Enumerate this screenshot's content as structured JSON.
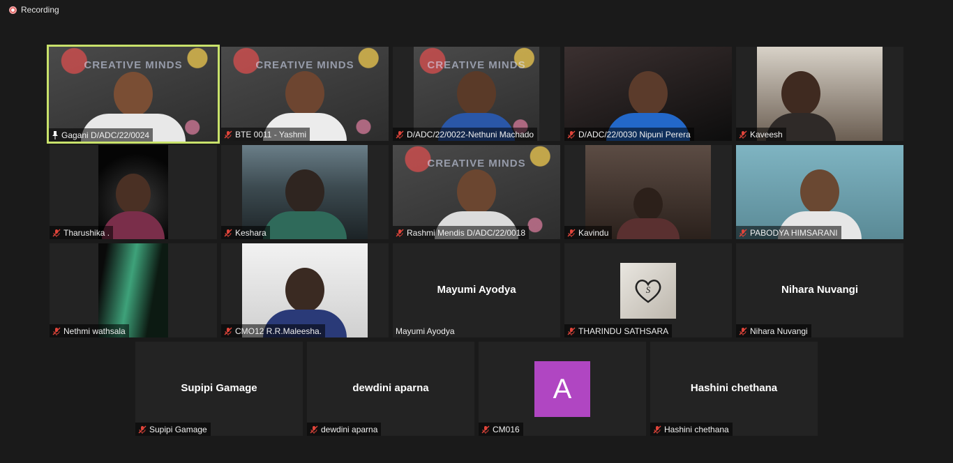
{
  "recording": {
    "label": "Recording"
  },
  "tiles": [
    {
      "name": "Gagani D/ADC/22/0024",
      "pinned": true
    },
    {
      "name": "BTE 0011 - Yashmi"
    },
    {
      "name": "D/ADC/22/0022-Nethuni Machado"
    },
    {
      "name": "D/ADC/22/0030 Nipuni Perera"
    },
    {
      "name": "Kaveesh"
    },
    {
      "name": "Tharushika ."
    },
    {
      "name": "Keshara"
    },
    {
      "name": "Rashmi Mendis D/ADC/22/0018"
    },
    {
      "name": "Kavindu"
    },
    {
      "name": "PABODYA HIMSARANI"
    },
    {
      "name": "Nethmi wathsala"
    },
    {
      "name": "CMO12 R.R.Maleesha."
    },
    {
      "name": "Mayumi Ayodya",
      "display": "Mayumi Ayodya"
    },
    {
      "name": "THARINDU SATHSARA",
      "avatar": "heart",
      "avatar_letter": "S"
    },
    {
      "name": "Nihara Nuvangi",
      "display": "Nihara Nuvangi"
    },
    {
      "name": "Supipi Gamage",
      "display": "Supipi Gamage"
    },
    {
      "name": "dewdini aparna",
      "display": "dewdini aparna"
    },
    {
      "name": "CM016",
      "avatar_letter": "A"
    },
    {
      "name": "Hashini chethana",
      "display": "Hashini chethana"
    }
  ],
  "chalkboard_text": "CREATIVE MINDS",
  "colors": {
    "active_border": "#c9e26b",
    "mute_icon": "#e0443a",
    "avatar_A": "#b046c2"
  }
}
